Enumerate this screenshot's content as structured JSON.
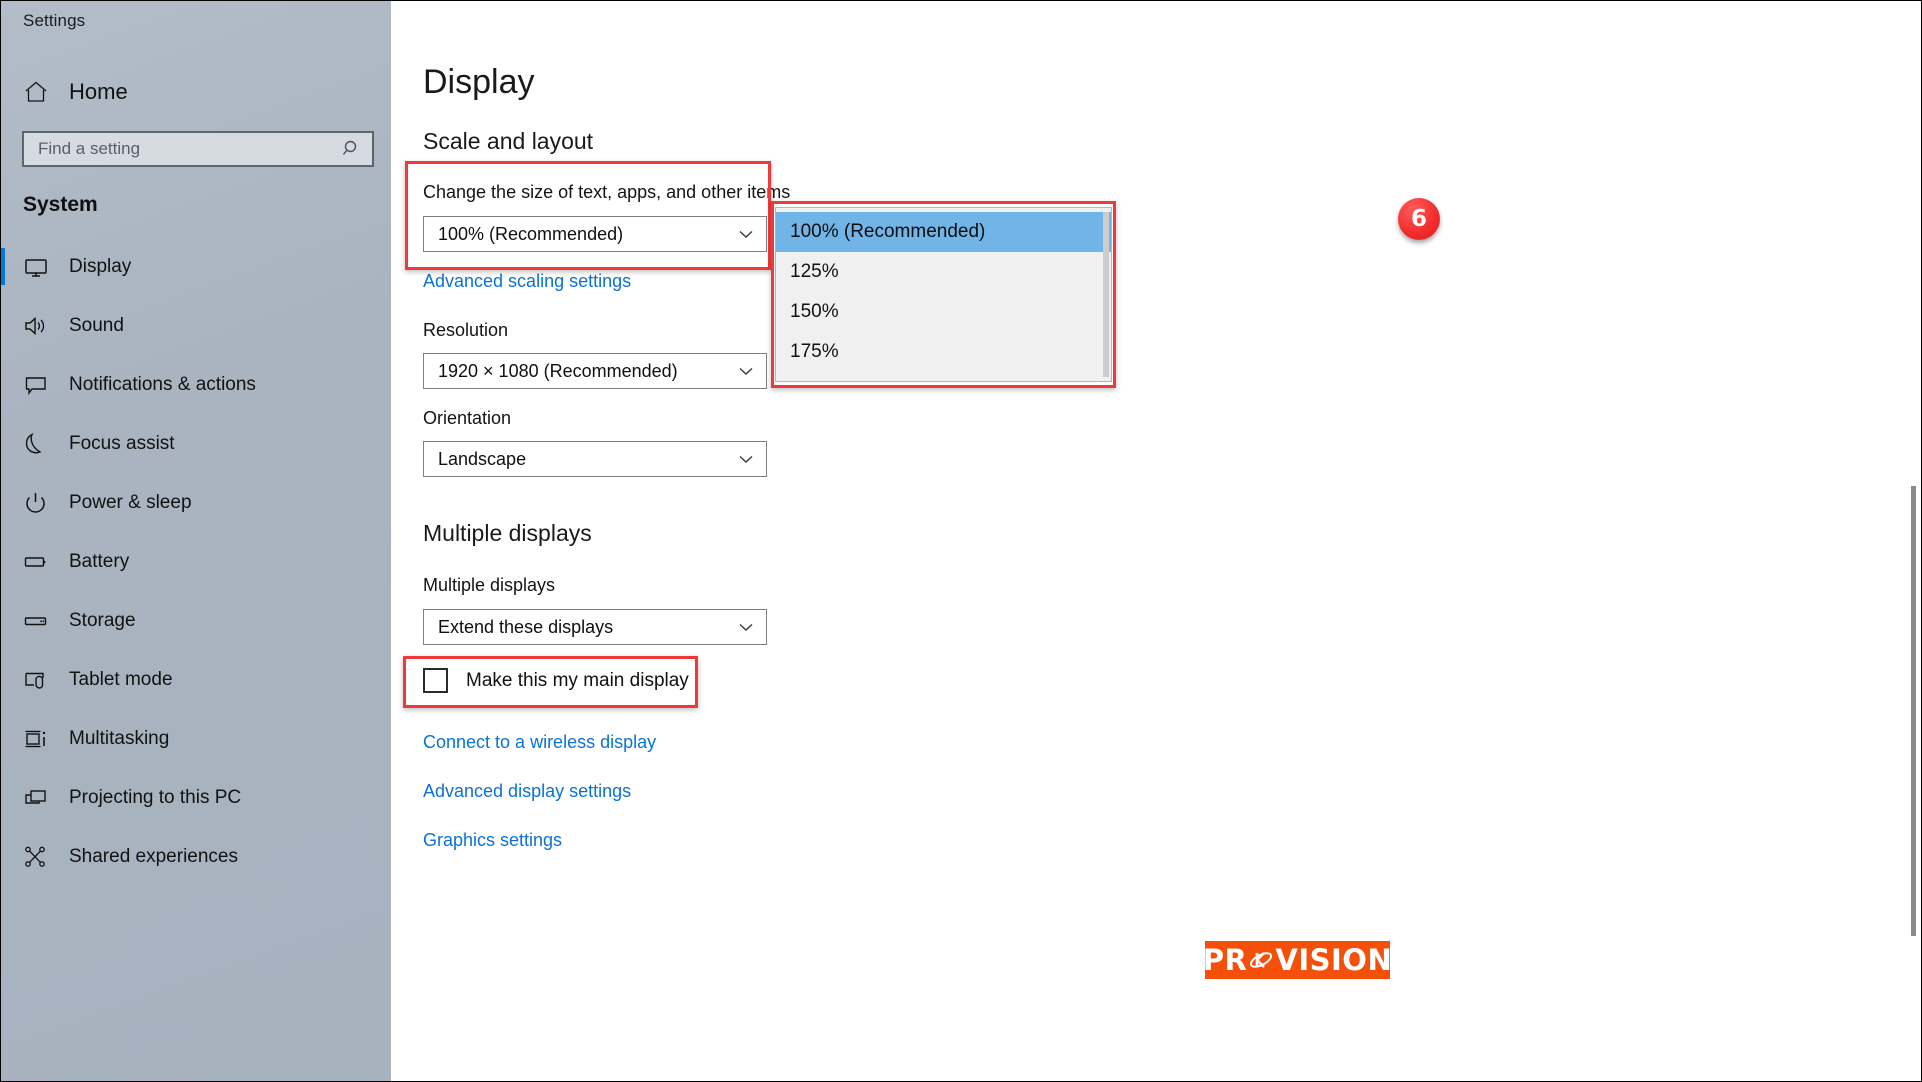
{
  "window": {
    "title": "Settings",
    "controls": [
      {
        "name": "minimize",
        "label": "—"
      },
      {
        "name": "restore",
        "label": "❐"
      },
      {
        "name": "close",
        "label": "✕"
      }
    ]
  },
  "sidebar": {
    "home_label": "Home",
    "search": {
      "placeholder": "Find a setting",
      "value": "",
      "icon": "search-icon"
    },
    "section_title": "System",
    "items": [
      {
        "label": "Display",
        "icon": "monitor-icon",
        "selected": true
      },
      {
        "label": "Sound",
        "icon": "speaker-icon",
        "selected": false
      },
      {
        "label": "Notifications & actions",
        "icon": "notification-icon",
        "selected": false
      },
      {
        "label": "Focus assist",
        "icon": "moon-icon",
        "selected": false
      },
      {
        "label": "Power & sleep",
        "icon": "power-icon",
        "selected": false
      },
      {
        "label": "Battery",
        "icon": "battery-icon",
        "selected": false
      },
      {
        "label": "Storage",
        "icon": "storage-icon",
        "selected": false
      },
      {
        "label": "Tablet mode",
        "icon": "tablet-icon",
        "selected": false
      },
      {
        "label": "Multitasking",
        "icon": "multitasking-icon",
        "selected": false
      },
      {
        "label": "Projecting to this PC",
        "icon": "projecting-icon",
        "selected": false
      },
      {
        "label": "Shared experiences",
        "icon": "share-icon",
        "selected": false
      }
    ]
  },
  "main": {
    "page_title": "Display",
    "scale_section": {
      "heading": "Scale and layout",
      "scale_label": "Change the size of text, apps, and other items",
      "scale_value": "100% (Recommended)",
      "advanced_scaling_link": "Advanced scaling settings",
      "resolution_label": "Resolution",
      "resolution_value": "1920 × 1080 (Recommended)",
      "orientation_label": "Orientation",
      "orientation_value": "Landscape"
    },
    "multiple_displays": {
      "heading": "Multiple displays",
      "field_label": "Multiple displays",
      "field_value": "Extend these displays",
      "checkbox_label": "Make this my main display",
      "checkbox_checked": false
    },
    "links": [
      "Connect to a wireless display",
      "Advanced display settings",
      "Graphics settings"
    ]
  },
  "dropdown": {
    "open": true,
    "options": [
      {
        "label": "100% (Recommended)",
        "selected": true
      },
      {
        "label": "125%",
        "selected": false
      },
      {
        "label": "150%",
        "selected": false
      },
      {
        "label": "175%",
        "selected": false
      }
    ]
  },
  "annotations": {
    "step_badge": "6",
    "highlight_color": "#ee3a3a"
  },
  "logo": {
    "text_before": "PR",
    "text_after": "VISION"
  },
  "colors": {
    "accent": "#0078d7",
    "link": "#0a73d4",
    "sidebar_bg": "#aab4c1",
    "highlight": "#ee3a3a",
    "dropdown_selected": "#70b4e8",
    "logo_bg": "#f4500a"
  }
}
